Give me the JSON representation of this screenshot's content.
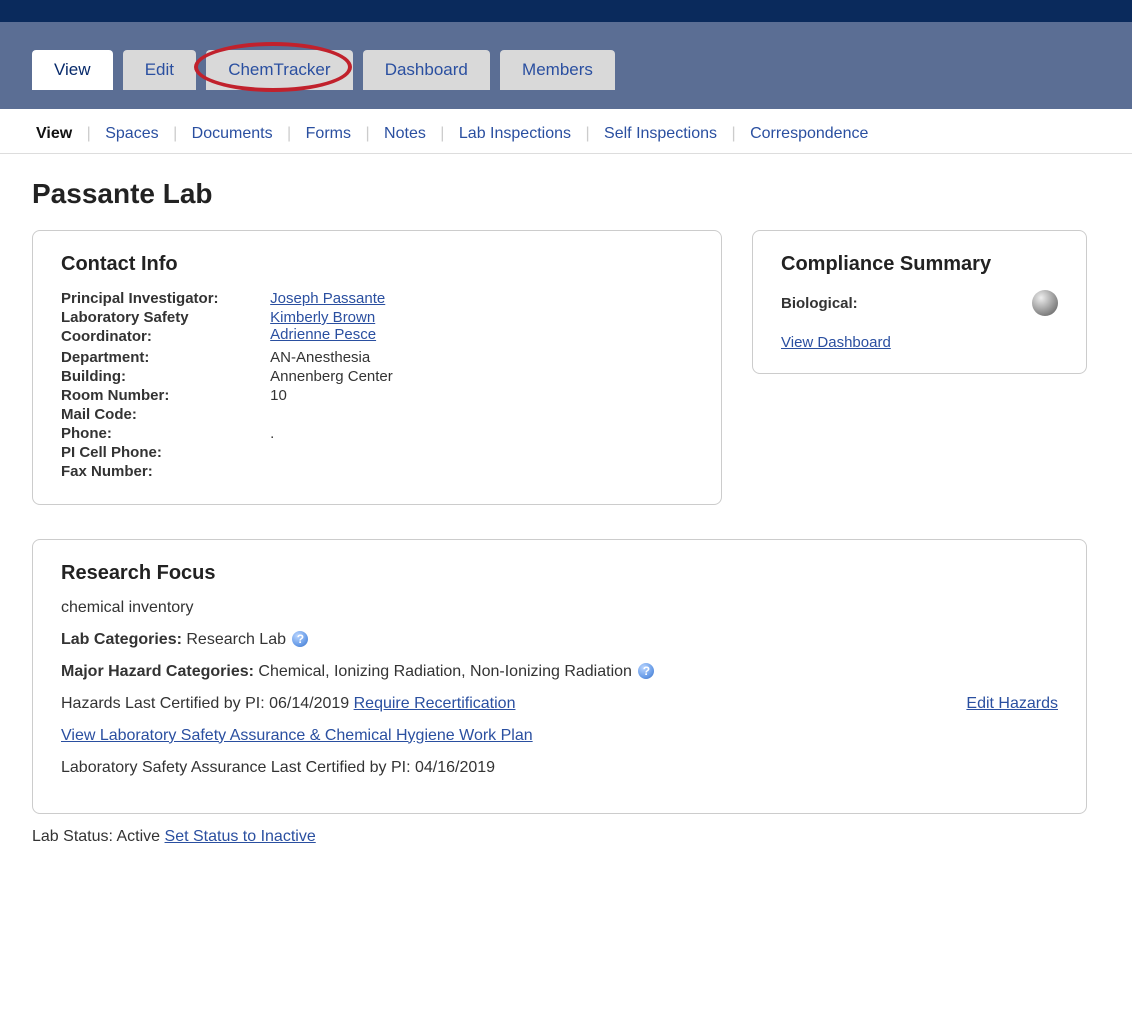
{
  "tabs": {
    "items": [
      {
        "label": "View",
        "active": true
      },
      {
        "label": "Edit"
      },
      {
        "label": "ChemTracker",
        "circled": true
      },
      {
        "label": "Dashboard"
      },
      {
        "label": "Members"
      }
    ]
  },
  "subtabs": {
    "items": [
      {
        "label": "View",
        "active": true
      },
      {
        "label": "Spaces"
      },
      {
        "label": "Documents"
      },
      {
        "label": "Forms"
      },
      {
        "label": "Notes"
      },
      {
        "label": "Lab Inspections"
      },
      {
        "label": "Self Inspections"
      },
      {
        "label": "Correspondence"
      }
    ]
  },
  "page": {
    "title": "Passante Lab"
  },
  "contact": {
    "heading": "Contact Info",
    "pi_label": "Principal Investigator:",
    "pi_value": "Joseph Passante",
    "lsc_label": "Laboratory Safety Coordinator:",
    "lsc_value1": "Kimberly Brown",
    "lsc_value2": "Adrienne Pesce",
    "dept_label": "Department:",
    "dept_value": "AN-Anesthesia",
    "building_label": "Building:",
    "building_value": "Annenberg Center",
    "room_label": "Room Number:",
    "room_value": "10",
    "mail_label": "Mail Code:",
    "mail_value": "",
    "phone_label": "Phone:",
    "phone_value": ".",
    "picell_label": "PI Cell Phone:",
    "picell_value": "",
    "fax_label": "Fax Number:",
    "fax_value": ""
  },
  "compliance": {
    "heading": "Compliance Summary",
    "bio_label": "Biological:",
    "dashboard_link": "View Dashboard"
  },
  "research": {
    "heading": "Research Focus",
    "focus_text": "chemical inventory",
    "lab_cat_label": "Lab Categories:",
    "lab_cat_value": "Research Lab",
    "major_haz_label": "Major Hazard Categories:",
    "major_haz_value": "Chemical, Ionizing Radiation, Non-Ionizing Radiation",
    "haz_cert_text": "Hazards Last Certified by PI: 06/14/2019 ",
    "require_recert": "Require Recertification",
    "edit_hazards": "Edit Hazards",
    "view_lsa_link": "View Laboratory Safety Assurance & Chemical Hygiene Work Plan",
    "lsa_cert_text": "Laboratory Safety Assurance Last Certified by PI: 04/16/2019"
  },
  "status": {
    "prefix": "Lab Status: Active ",
    "link": "Set Status to Inactive"
  }
}
